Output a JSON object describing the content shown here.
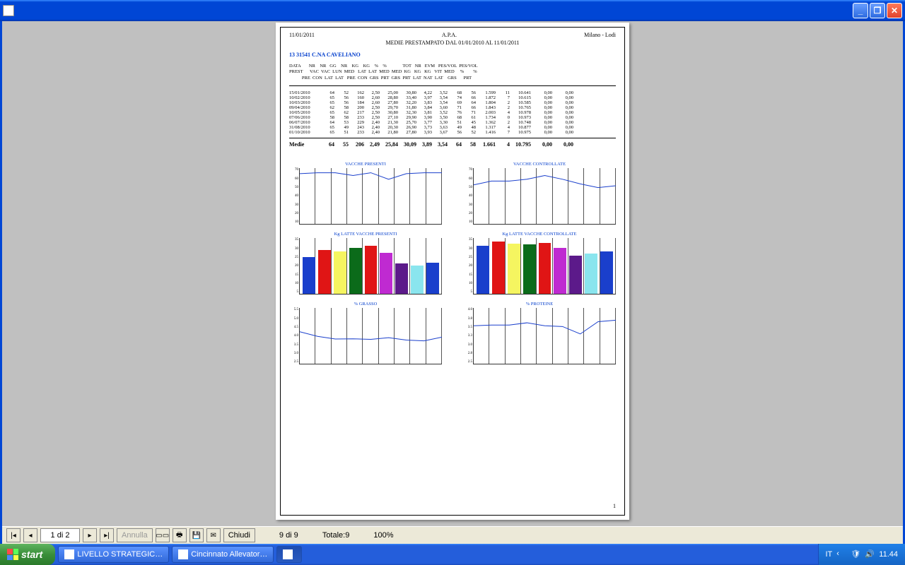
{
  "titlebar": {
    "text": ""
  },
  "report": {
    "date_printed": "11/01/2011",
    "title": "MEDIE PRESTAMPATO   DAL        01/01/2010    AL        11/01/2011",
    "org": "A.P.A.",
    "city": "Milano - Lodi",
    "farm": "13      31541    C.NA CAVELIANO",
    "col_lines": [
      "DATA       NR    NR   GG    NR    KG    KG    %    %              TOT   NR   EVM   PES/VOL  PES/VOL",
      "PREST      VAC  VAC  LUN  MED   LAT  LAT  MED  MED  KG   KG   KG   VIT  MED     %        %",
      "           PRE  CON  LAT  LAT   PRE  CON  GRS  PRT  GRS  PRT  LAT  NAT  LAT    GRS      PRT"
    ],
    "rows": [
      [
        "15/01/2010",
        "64",
        "52",
        "162",
        "2,50",
        "25,00",
        "30,80",
        "4,22",
        "3,52",
        "68",
        "56",
        "1.599",
        "11",
        "10.641",
        "0,00",
        "0,00"
      ],
      [
        "10/02/2010",
        "65",
        "56",
        "160",
        "2,60",
        "28,80",
        "33,40",
        "3,97",
        "3,54",
        "74",
        "66",
        "1.872",
        "7",
        "10.615",
        "0,00",
        "0,00"
      ],
      [
        "10/03/2010",
        "65",
        "56",
        "184",
        "2,60",
        "27,80",
        "32,20",
        "3,83",
        "3,54",
        "69",
        "64",
        "1.804",
        "2",
        "10.585",
        "0,00",
        "0,00"
      ],
      [
        "09/04/2010",
        "62",
        "58",
        "200",
        "2,50",
        "29,70",
        "31,80",
        "3,84",
        "3,60",
        "71",
        "66",
        "1.843",
        "2",
        "10.765",
        "0,00",
        "0,00"
      ],
      [
        "10/05/2010",
        "65",
        "62",
        "217",
        "2,50",
        "30,80",
        "32,30",
        "3,81",
        "3,52",
        "76",
        "71",
        "2.003",
        "4",
        "10.978",
        "0,00",
        "0,00"
      ],
      [
        "07/06/2010",
        "58",
        "58",
        "233",
        "2,50",
        "27,10",
        "29,90",
        "3,90",
        "3,50",
        "68",
        "61",
        "1.734",
        "0",
        "10.973",
        "0,00",
        "0,00"
      ],
      [
        "06/07/2010",
        "64",
        "53",
        "229",
        "2,40",
        "21,30",
        "25,70",
        "3,77",
        "3,30",
        "51",
        "45",
        "1.362",
        "2",
        "10.748",
        "0,00",
        "0,00"
      ],
      [
        "31/08/2010",
        "65",
        "49",
        "243",
        "2,40",
        "20,30",
        "26,90",
        "3,73",
        "3,63",
        "49",
        "48",
        "1.317",
        "4",
        "10.877",
        "0,00",
        "0,00"
      ],
      [
        "01/10/2010",
        "65",
        "51",
        "233",
        "2,40",
        "21,80",
        "27,80",
        "3,93",
        "3,67",
        "56",
        "52",
        "1.416",
        "7",
        "10.975",
        "0,00",
        "0,00"
      ]
    ],
    "avg_label": "Medie",
    "avg": [
      "64",
      "55",
      "206",
      "2,49",
      "25,84",
      "30,09",
      "3,89",
      "3,54",
      "64",
      "58",
      "1.661",
      "4",
      "10.795",
      "0,00",
      "0,00"
    ],
    "page_num": "1"
  },
  "chart_data": [
    {
      "type": "line",
      "title": "VACCHE PRESENTI",
      "ylim": [
        10,
        70
      ],
      "yticks": [
        "70",
        "60",
        "50",
        "40",
        "30",
        "20",
        "10"
      ],
      "values": [
        64,
        65,
        65,
        62,
        65,
        58,
        64,
        65,
        65
      ]
    },
    {
      "type": "line",
      "title": "VACCHE CONTROLLATE",
      "ylim": [
        10,
        70
      ],
      "yticks": [
        "70",
        "60",
        "50",
        "40",
        "30",
        "20",
        "10"
      ],
      "values": [
        52,
        56,
        56,
        58,
        62,
        58,
        53,
        49,
        51
      ]
    },
    {
      "type": "bar",
      "title": "Kg LATTE VACCHE PRESENTI",
      "ylim": [
        5,
        35
      ],
      "yticks": [
        "35",
        "30",
        "25",
        "20",
        "15",
        "10",
        "5"
      ],
      "values": [
        25.0,
        28.8,
        27.8,
        29.7,
        30.8,
        27.1,
        21.3,
        20.3,
        21.8
      ],
      "colors": [
        "#1a3fcc",
        "#e01515",
        "#f5f560",
        "#0b6b1a",
        "#e01515",
        "#bf2ad1",
        "#5c1a8a",
        "#8ae5ee",
        "#1a3fcc"
      ]
    },
    {
      "type": "bar",
      "title": "Kg LATTE VACCHE CONTROLLATE",
      "ylim": [
        5,
        35
      ],
      "yticks": [
        "35",
        "30",
        "25",
        "20",
        "15",
        "10",
        "5"
      ],
      "values": [
        30.8,
        33.4,
        32.2,
        31.8,
        32.3,
        29.9,
        25.7,
        26.9,
        27.8
      ],
      "colors": [
        "#1a3fcc",
        "#e01515",
        "#f5f560",
        "#0b6b1a",
        "#e01515",
        "#bf2ad1",
        "#5c1a8a",
        "#8ae5ee",
        "#1a3fcc"
      ]
    },
    {
      "type": "line",
      "title": "% GRASSO",
      "ylim": [
        2.5,
        5.5
      ],
      "yticks": [
        "5.5",
        "5.0",
        "4.5",
        "4.0",
        "3.5",
        "3.0",
        "2.5"
      ],
      "values": [
        4.22,
        3.97,
        3.83,
        3.84,
        3.81,
        3.9,
        3.77,
        3.73,
        3.93
      ]
    },
    {
      "type": "line",
      "title": "% PROTEINE",
      "ylim": [
        2.5,
        4.0
      ],
      "yticks": [
        "4.0",
        "3.8",
        "3.5",
        "3.3",
        "3.0",
        "2.8",
        "2.5"
      ],
      "values": [
        3.52,
        3.54,
        3.54,
        3.6,
        3.52,
        3.5,
        3.3,
        3.63,
        3.67
      ]
    }
  ],
  "toolbar": {
    "page_of": "1 di 2",
    "annulla": "Annulla",
    "chiudi": "Chiudi",
    "status_rec": "9 di 9",
    "status_total": "Totale:9",
    "zoom": "100%"
  },
  "taskbar": {
    "start": "start",
    "items": [
      "LIVELLO STRATEGIC…",
      "Cincinnato Allevator…",
      ""
    ],
    "lang": "IT",
    "clock": "11.44"
  }
}
